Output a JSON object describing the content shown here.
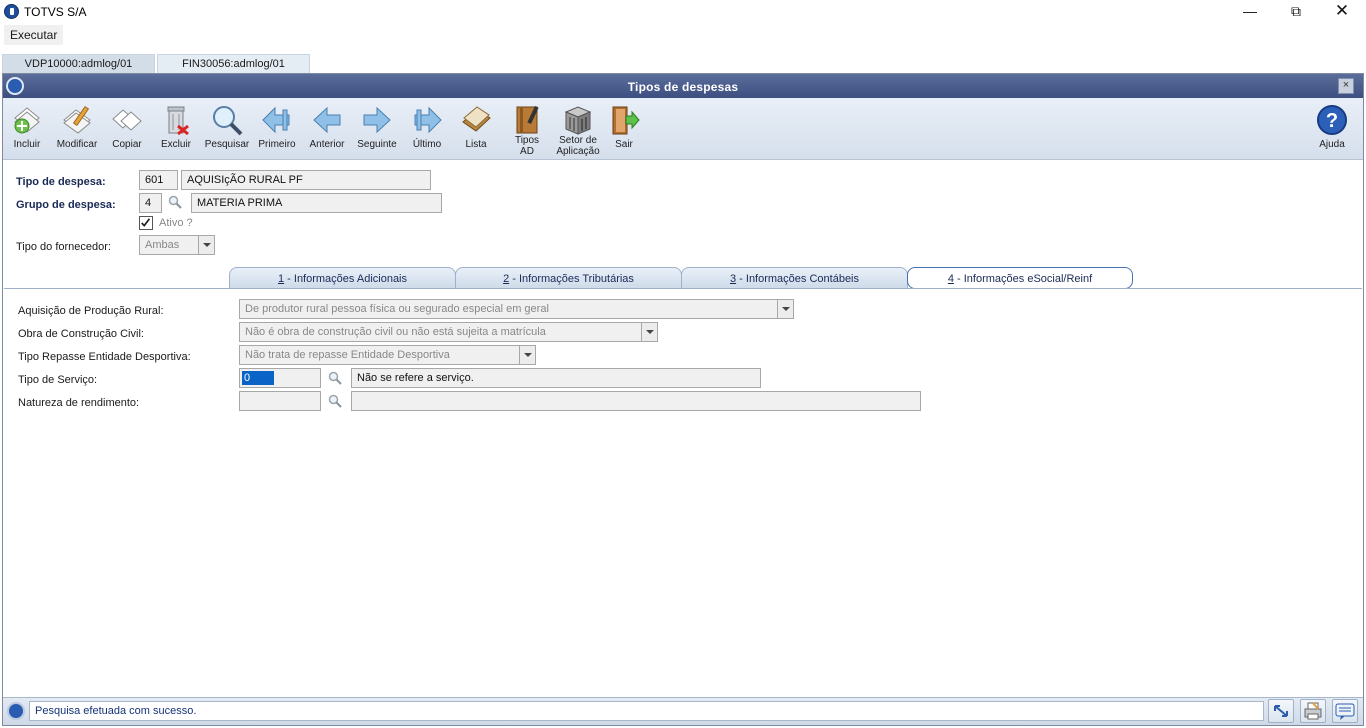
{
  "app": {
    "title": "TOTVS S/A",
    "menu": [
      "Executar"
    ],
    "program_tabs": [
      "VDP10000:admlog/01",
      "FIN30056:admlog/01"
    ]
  },
  "window": {
    "title": "Tipos de despesas",
    "close_label": "×"
  },
  "toolbar": {
    "incluir": "Incluir",
    "modificar": "Modificar",
    "copiar": "Copiar",
    "excluir": "Excluir",
    "pesquisar": "Pesquisar",
    "primeiro": "Primeiro",
    "anterior": "Anterior",
    "seguinte": "Seguinte",
    "ultimo": "Último",
    "lista": "Lista",
    "tipos_ad_1": "Tipos",
    "tipos_ad_2": "AD",
    "setor_1": "Setor de",
    "setor_2": "Aplicação",
    "sair": "Sair",
    "ajuda": "Ajuda"
  },
  "form": {
    "tipo_despesa_label": "Tipo de despesa:",
    "tipo_despesa_code": "601",
    "tipo_despesa_desc": "AQUISIçÃO RURAL PF",
    "grupo_despesa_label": "Grupo de despesa:",
    "grupo_despesa_code": "4",
    "grupo_despesa_desc": "MATERIA PRIMA",
    "ativo_label": "Ativo ?",
    "ativo_checked": true,
    "tipo_fornecedor_label": "Tipo do fornecedor:",
    "tipo_fornecedor_value": "Ambas"
  },
  "subtabs": [
    {
      "num": "1",
      "label": " - Informações Adicionais"
    },
    {
      "num": "2",
      "label": " - Informações Tributárias"
    },
    {
      "num": "3",
      "label": " - Informações Contábeis"
    },
    {
      "num": "4",
      "label": " - Informações eSocial/Reinf"
    }
  ],
  "esocial": {
    "aquisicao_label": "Aquisição de Produção Rural:",
    "aquisicao_value": "De produtor rural pessoa física ou segurado especial em geral",
    "obra_label": "Obra de Construção Civil:",
    "obra_value": "Não é obra de construção civil ou não está sujeita a matrícula",
    "repasse_label": "Tipo Repasse Entidade Desportiva:",
    "repasse_value": "Não trata de repasse Entidade Desportiva",
    "servico_label": "Tipo de Serviço:",
    "servico_code": "0",
    "servico_desc": "Não se refere a serviço.",
    "natureza_label": "Natureza de rendimento:",
    "natureza_code": "",
    "natureza_desc": ""
  },
  "status": {
    "message": "Pesquisa efetuada com sucesso."
  },
  "colors": {
    "header": "#3c4f80",
    "toolbar": "#dce5f0",
    "label_blue": "#1a2a56"
  }
}
